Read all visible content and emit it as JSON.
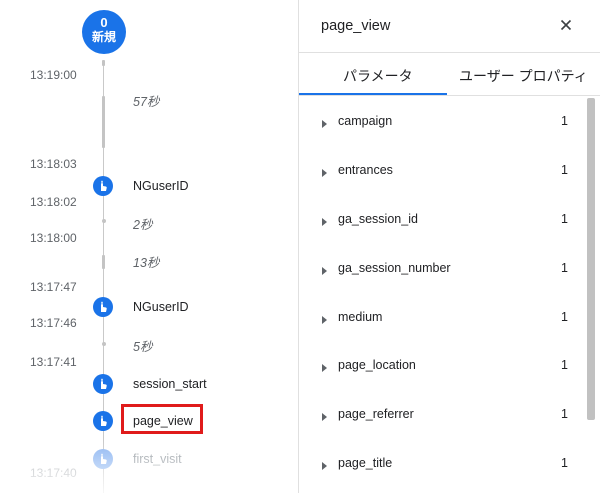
{
  "timeline": {
    "new_badge": {
      "count": "0",
      "label": "新規"
    },
    "times": [
      "13:19:00",
      "13:18:03",
      "13:18:02",
      "13:18:00",
      "13:17:47",
      "13:17:46",
      "13:17:41",
      "13:17:40"
    ],
    "gaps": [
      "57秒",
      "2秒",
      "13秒",
      "5秒"
    ],
    "events": [
      "NGuserID",
      "NGuserID",
      "session_start",
      "page_view",
      "first_visit"
    ]
  },
  "detail": {
    "title": "page_view",
    "close_label": "×",
    "tabs": [
      "パラメータ",
      "ユーザー プロパティ"
    ],
    "params": [
      {
        "name": "campaign",
        "count": "1"
      },
      {
        "name": "entrances",
        "count": "1"
      },
      {
        "name": "ga_session_id",
        "count": "1"
      },
      {
        "name": "ga_session_number",
        "count": "1"
      },
      {
        "name": "medium",
        "count": "1"
      },
      {
        "name": "page_location",
        "count": "1"
      },
      {
        "name": "page_referrer",
        "count": "1"
      },
      {
        "name": "page_title",
        "count": "1"
      }
    ]
  },
  "colors": {
    "accent": "#1a73e8",
    "highlight": "#e01b1b"
  }
}
